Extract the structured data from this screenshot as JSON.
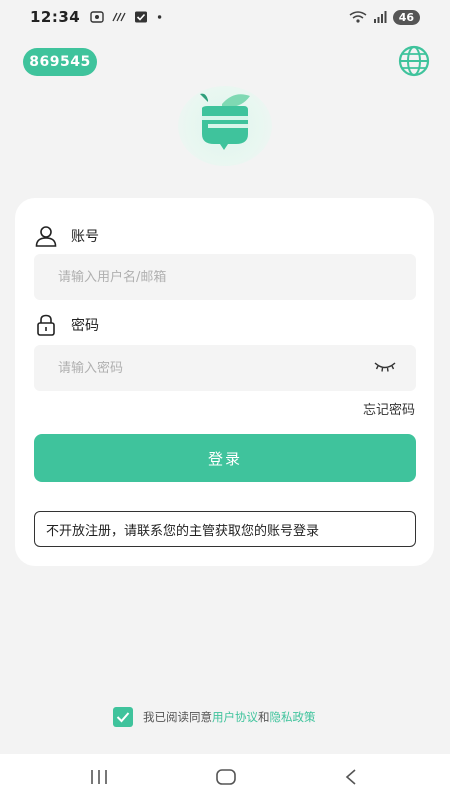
{
  "status_bar": {
    "time": "12:34",
    "battery": "46",
    "icons": [
      "screen-record-icon",
      "nfc-icon",
      "check-box-icon",
      "dot-icon",
      "wifi-icon",
      "signal-icon",
      "battery-icon"
    ]
  },
  "header": {
    "id_badge": "869545",
    "language_icon": "globe-icon"
  },
  "logo": {
    "icon": "app-logo-icon"
  },
  "form": {
    "account": {
      "label": "账号",
      "placeholder": "请输入用户名/邮箱",
      "value": "",
      "icon": "user-icon"
    },
    "password": {
      "label": "密码",
      "placeholder": "请输入密码",
      "value": "",
      "icon": "lock-icon",
      "toggle_icon": "eye-closed-icon"
    },
    "forgot_password": "忘记密码",
    "login_button": "登录",
    "notice": "不开放注册，请联系您的主管获取您的账号登录"
  },
  "agreement": {
    "checked": true,
    "prefix": "我已阅读同意",
    "user_agreement": "用户协议",
    "and": "和",
    "privacy_policy": "隐私政策"
  },
  "nav_bar": {
    "icons": [
      "recent-apps-icon",
      "home-icon",
      "back-icon"
    ]
  },
  "colors": {
    "accent": "#3fc39c",
    "background": "#f3f3f3",
    "card": "#ffffff",
    "input": "#f4f4f4"
  }
}
